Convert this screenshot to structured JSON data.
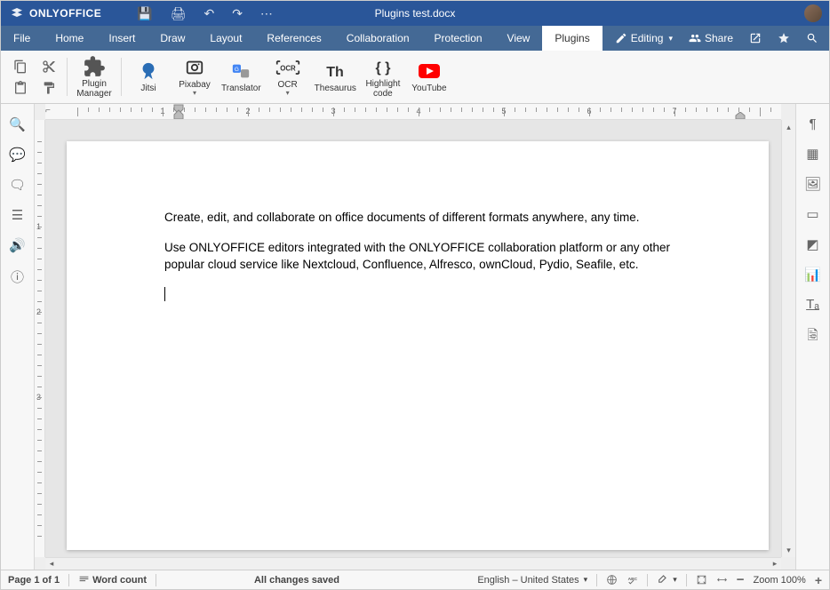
{
  "app": {
    "name": "ONLYOFFICE",
    "doc_title": "Plugins test.docx"
  },
  "titlebar_actions": {
    "editing": "Editing",
    "share": "Share"
  },
  "menu": {
    "items": [
      {
        "label": "File"
      },
      {
        "label": "Home"
      },
      {
        "label": "Insert"
      },
      {
        "label": "Draw"
      },
      {
        "label": "Layout"
      },
      {
        "label": "References"
      },
      {
        "label": "Collaboration"
      },
      {
        "label": "Protection"
      },
      {
        "label": "View"
      },
      {
        "label": "Plugins"
      }
    ],
    "active": "Plugins"
  },
  "ribbon": {
    "plugin_manager": "Plugin\nManager",
    "plugins": [
      {
        "name": "Jitsi",
        "hasCaret": false
      },
      {
        "name": "Pixabay",
        "hasCaret": true
      },
      {
        "name": "Translator",
        "hasCaret": false
      },
      {
        "name": "OCR",
        "hasCaret": true
      },
      {
        "name": "Thesaurus",
        "hasCaret": false
      },
      {
        "name": "Highlight\ncode",
        "hasCaret": false
      },
      {
        "name": "YouTube",
        "hasCaret": false
      }
    ]
  },
  "document": {
    "p1": "Create, edit, and collaborate on office documents of different formats anywhere, any time.",
    "p2": "Use ONLYOFFICE editors integrated with the ONLYOFFICE collaboration platform or any other popular cloud service like Nextcloud, Confluence, Alfresco, ownCloud, Pydio, Seafile, etc."
  },
  "ruler": {
    "ticks": [
      "1",
      "2",
      "3",
      "4",
      "5",
      "6",
      "7"
    ]
  },
  "vruler": {
    "ticks": [
      "1",
      "2",
      "3"
    ]
  },
  "status": {
    "page": "Page 1 of 1",
    "wordcount": "Word count",
    "saved": "All changes saved",
    "language": "English – United States",
    "zoom": "Zoom 100%"
  }
}
